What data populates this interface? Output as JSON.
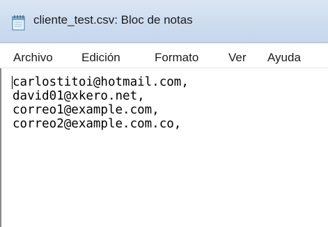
{
  "window": {
    "title": "cliente_test.csv: Bloc de notas",
    "icon": "notepad-icon"
  },
  "menubar": {
    "items": [
      {
        "label": "Archivo"
      },
      {
        "label": "Edición"
      },
      {
        "label": "Formato"
      },
      {
        "label": "Ver"
      },
      {
        "label": "Ayuda"
      }
    ]
  },
  "editor": {
    "content": "carlostitoi@hotmail.com,\ndavid01@xkero.net,\ncorreo1@example.com,\ncorreo2@example.com.co,"
  },
  "colors": {
    "titlebar": "#cfdeef",
    "text": "#000000",
    "background": "#ffffff"
  }
}
